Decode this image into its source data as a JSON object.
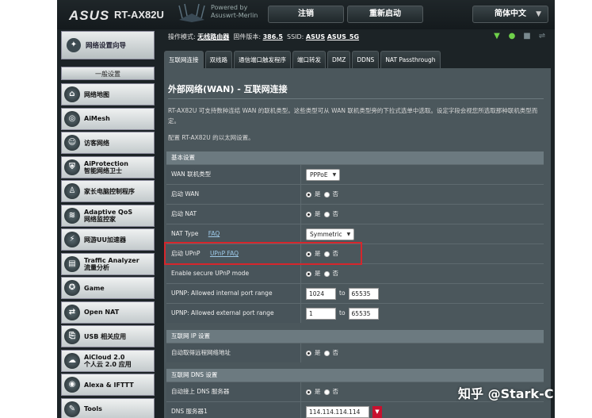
{
  "header": {
    "brand": "ASUS",
    "model": "RT-AX82U",
    "powered_by": "Powered by",
    "powered_name": "Asuswrt-Merlin",
    "logout": "注销",
    "reboot": "重新启动",
    "language": "简体中文"
  },
  "sidebar": {
    "quick_setup": "网络设置向导",
    "general": "一般设置",
    "items": [
      {
        "label": "网络地图",
        "icon": "network-map-icon"
      },
      {
        "label": "AiMesh",
        "icon": "aimesh-icon"
      },
      {
        "label": "访客网络",
        "icon": "guest-network-icon"
      },
      {
        "label": "AiProtection\n智能网络卫士",
        "icon": "aiprotection-icon"
      },
      {
        "label": "家长电脑控制程序",
        "icon": "parental-control-icon"
      },
      {
        "label": "Adaptive QoS\n网络监控家",
        "icon": "qos-icon"
      },
      {
        "label": "网游UU加速器",
        "icon": "uu-accelerator-icon"
      },
      {
        "label": "Traffic Analyzer\n流量分析",
        "icon": "traffic-analyzer-icon"
      },
      {
        "label": "Game",
        "icon": "game-icon"
      },
      {
        "label": "Open NAT",
        "icon": "open-nat-icon"
      },
      {
        "label": "USB 相关应用",
        "icon": "usb-icon"
      },
      {
        "label": "AiCloud 2.0\n个人云 2.0 应用",
        "icon": "aicloud-icon"
      },
      {
        "label": "Alexa & IFTTT",
        "icon": "alexa-icon"
      },
      {
        "label": "Tools",
        "icon": "tools-icon"
      }
    ]
  },
  "status": {
    "mode_label": "操作模式:",
    "mode_value": "无线路由器",
    "fw_label": "固件版本:",
    "fw_value": "386.5",
    "ssid_label": "SSID:",
    "ssid_values": [
      "ASUS",
      "ASUS_5G"
    ]
  },
  "tabs": [
    "互联网连接",
    "双线路",
    "通信端口触发程序",
    "端口转发",
    "DMZ",
    "DDNS",
    "NAT Passthrough"
  ],
  "page": {
    "title": "外部网络(WAN) - 互联网连接",
    "description": "RT-AX82U 可支持数种连结 WAN 的联机类型。这些类型可从 WAN 联机类型旁的下拉式选单中选取。设定字段会视您所选取那种联机类型而定。",
    "config": "配置 RT-AX82U 的以太网设置。"
  },
  "sections": {
    "basic": "基本设置",
    "ip": "互联网 IP 设置",
    "dns": "互联网 DNS 设置"
  },
  "rows": {
    "wan_type_label": "WAN 联机类型",
    "wan_type_value": "PPPoE",
    "enable_wan_label": "启动 WAN",
    "enable_nat_label": "启动 NAT",
    "nat_type_label": "NAT Type",
    "nat_faq": "FAQ",
    "nat_type_value": "Symmetric",
    "upnp_label": "启动 UPnP",
    "upnp_faq": "UPnP FAQ",
    "secure_upnp_label": "Enable secure UPnP mode",
    "int_range_label": "UPNP: Allowed internal port range",
    "int_from": "1024",
    "int_to": "65535",
    "ext_range_label": "UPNP: Allowed external port range",
    "ext_from": "1",
    "ext_to": "65535",
    "auto_ip_label": "自动取得远程网络地址",
    "auto_dns_label": "自动接上 DNS 服务器",
    "dns1_label": "DNS 服务器1",
    "dns1_value": "114.114.114.114",
    "yes": "是",
    "no": "否",
    "to": "to"
  },
  "watermark": "知乎 @Stark-C"
}
